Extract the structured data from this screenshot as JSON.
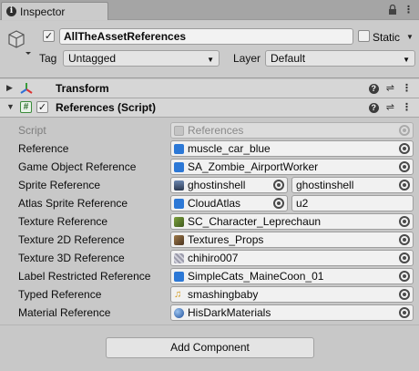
{
  "tab": {
    "title": "Inspector",
    "icon": "info-icon"
  },
  "tab_tools": {
    "lock_icon": "lock-icon",
    "menu_icon": "kebab-menu-icon",
    "menu_glyph": "⋮",
    "lock_glyph": "🔒"
  },
  "header": {
    "object_name": "AllTheAssetReferences",
    "active": true,
    "static_label": "Static",
    "static_checked": false,
    "tag_label": "Tag",
    "tag_value": "Untagged",
    "layer_label": "Layer",
    "layer_value": "Default"
  },
  "components": [
    {
      "title": "Transform",
      "expanded": false,
      "icon": "transform-axes-icon"
    },
    {
      "title": "References (Script)",
      "expanded": true,
      "enabled": true,
      "icon": "script-hash-icon"
    }
  ],
  "properties": [
    {
      "label": "Script",
      "value": "References",
      "icon": "script-asset-icon",
      "icon_color": "#b9b9b9",
      "disabled": true
    },
    {
      "label": "Reference",
      "value": "muscle_car_blue",
      "icon": "prefab-cube-icon",
      "icon_color": "#2c78d6"
    },
    {
      "label": "Game Object Reference",
      "value": "SA_Zombie_AirportWorker",
      "icon": "prefab-cube-icon",
      "icon_color": "#2c78d6"
    },
    {
      "label": "Sprite Reference",
      "value": "ghostinshell",
      "icon": "sprite-icon",
      "icon_color": "#3a4a66",
      "extra": "ghostinshell"
    },
    {
      "label": "Atlas Sprite Reference",
      "value": "CloudAtlas",
      "icon": "prefab-cube-icon",
      "icon_color": "#2c78d6",
      "extra": "u2"
    },
    {
      "label": "Texture Reference",
      "value": "SC_Character_Leprechaun",
      "icon": "texture-icon",
      "icon_color": "#5b7a2e"
    },
    {
      "label": "Texture 2D Reference",
      "value": "Textures_Props",
      "icon": "texture-icon",
      "icon_color": "#7a5a3a"
    },
    {
      "label": "Texture 3D Reference",
      "value": "chihiro007",
      "icon": "texture3d-icon",
      "icon_color": "#8a8a9a"
    },
    {
      "label": "Label Restricted Reference",
      "value": "SimpleCats_MaineCoon_01",
      "icon": "prefab-cube-icon",
      "icon_color": "#2c78d6"
    },
    {
      "label": "Typed Reference",
      "value": "smashingbaby",
      "icon": "audio-clip-icon",
      "icon_color": "#d49a1e"
    },
    {
      "label": "Material Reference",
      "value": "HisDarkMaterials",
      "icon": "material-sphere-icon",
      "icon_color": "#2f6fc8"
    }
  ],
  "footer": {
    "add_component_label": "Add Component"
  }
}
